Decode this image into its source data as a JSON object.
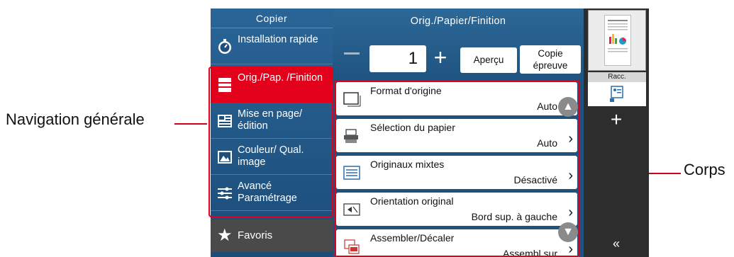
{
  "callouts": {
    "left": "Navigation générale",
    "right": "Corps"
  },
  "nav": {
    "title": "Copier",
    "items": [
      {
        "label": "Installation rapide",
        "icon": "stopwatch-icon"
      },
      {
        "label": "Orig./Pap. /Finition",
        "icon": "paper-stack-icon",
        "active": true
      },
      {
        "label": "Mise en page/édition",
        "icon": "layout-icon"
      },
      {
        "label": "Couleur/ Qual. image",
        "icon": "image-quality-icon"
      },
      {
        "label": "Avancé Paramétrage",
        "icon": "sliders-icon"
      }
    ],
    "favorites": "Favoris"
  },
  "main": {
    "title": "Orig./Papier/Finition",
    "quantity": "1",
    "preview_button": "Aperçu",
    "proof_button": "Copie épreuve",
    "rows": [
      {
        "label": "Format d'origine",
        "value": "Auto",
        "icon": "original-size-icon"
      },
      {
        "label": "Sélection du papier",
        "value": "Auto",
        "icon": "paper-tray-icon"
      },
      {
        "label": "Originaux mixtes",
        "value": "Désactivé",
        "icon": "mixed-originals-icon"
      },
      {
        "label": "Orientation original",
        "value": "Bord sup. à gauche",
        "icon": "orientation-icon"
      },
      {
        "label": "Assembler/Décaler",
        "value": "Assembl.sur",
        "icon": "collate-icon"
      }
    ]
  },
  "right_panel": {
    "shortcut_label": "Racc."
  },
  "colors": {
    "accent": "#e2001a",
    "screen_blue": "#1d4f7a",
    "panel_dark": "#2d2d2d"
  }
}
